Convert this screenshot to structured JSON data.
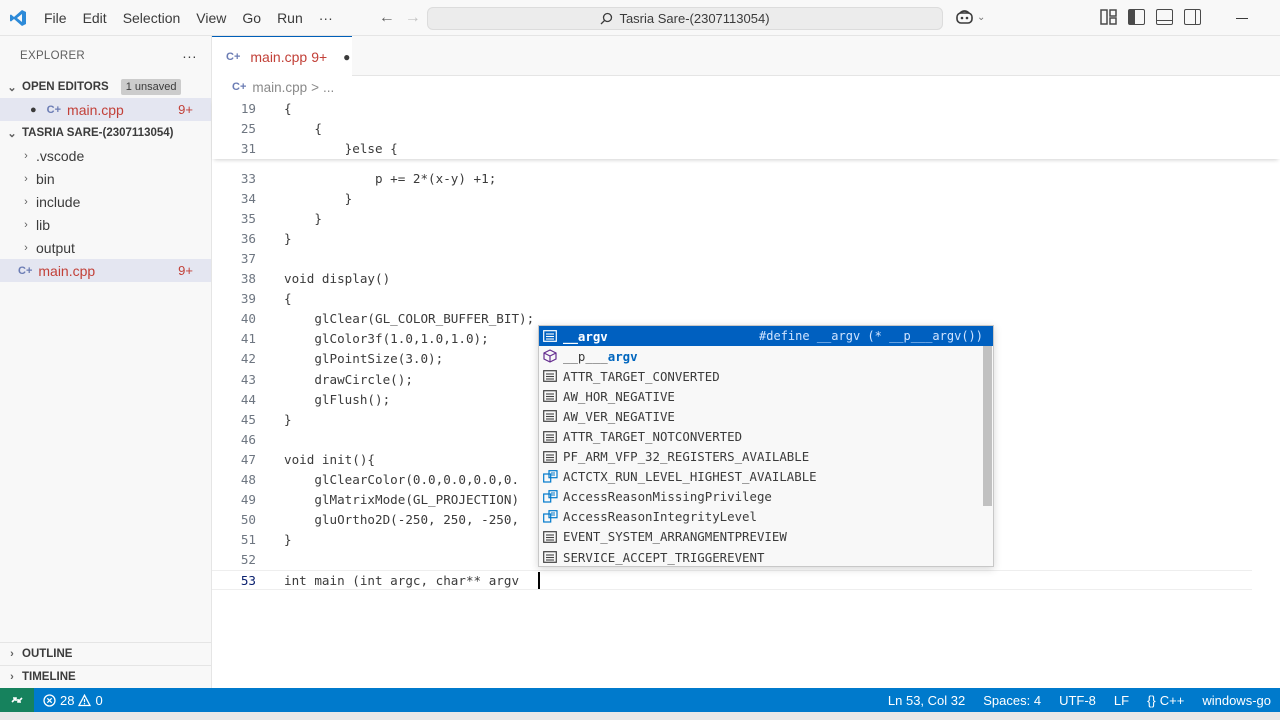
{
  "menu": [
    "File",
    "Edit",
    "Selection",
    "View",
    "Go",
    "Run",
    "···"
  ],
  "command_center": "Tasria Sare-(2307113054)",
  "sidebar": {
    "title": "EXPLORER",
    "more": "···",
    "open_editors": {
      "label": "OPEN EDITORS",
      "badge": "1 unsaved",
      "file": "main.cpp",
      "count": "9+"
    },
    "folder": {
      "label": "TASRIA SARE-(2307113054)",
      "items": [
        ".vscode",
        "bin",
        "include",
        "lib",
        "output"
      ],
      "file": "main.cpp",
      "count": "9+"
    },
    "outline": "OUTLINE",
    "timeline": "TIMELINE"
  },
  "tab": {
    "label": "main.cpp",
    "count": "9+",
    "dirty": "●"
  },
  "breadcrumb": {
    "file": "main.cpp",
    "sep": ">",
    "rest": "..."
  },
  "code": {
    "sticky": [
      {
        "n": "19",
        "t": "{"
      },
      {
        "n": "25",
        "t": "    {"
      },
      {
        "n": "31",
        "t": "        }else {"
      }
    ],
    "lines": [
      {
        "n": "33",
        "t": "            p += 2*(x-y) +1;"
      },
      {
        "n": "34",
        "t": "        }"
      },
      {
        "n": "35",
        "t": "    }"
      },
      {
        "n": "36",
        "t": "}"
      },
      {
        "n": "37",
        "t": ""
      },
      {
        "n": "38",
        "t": "void display()"
      },
      {
        "n": "39",
        "t": "{"
      },
      {
        "n": "40",
        "t": "    glClear(GL_COLOR_BUFFER_BIT);"
      },
      {
        "n": "41",
        "t": "    glColor3f(1.0,1.0,1.0);"
      },
      {
        "n": "42",
        "t": "    glPointSize(3.0);"
      },
      {
        "n": "43",
        "t": "    drawCircle();"
      },
      {
        "n": "44",
        "t": "    glFlush();"
      },
      {
        "n": "45",
        "t": "}"
      },
      {
        "n": "46",
        "t": ""
      },
      {
        "n": "47",
        "t": "void init(){"
      },
      {
        "n": "48",
        "t": "    glClearColor(0.0,0.0,0.0,0."
      },
      {
        "n": "49",
        "t": "    glMatrixMode(GL_PROJECTION)"
      },
      {
        "n": "50",
        "t": "    gluOrtho2D(-250, 250, -250,"
      },
      {
        "n": "51",
        "t": "}"
      },
      {
        "n": "52",
        "t": ""
      },
      {
        "n": "53",
        "t": "int main (int argc, char** argv"
      }
    ]
  },
  "suggest": {
    "detail": "#define __argv (* __p___argv())",
    "items": [
      {
        "icon": "text",
        "pre": "",
        "hl": "__argv",
        "post": ""
      },
      {
        "icon": "cube",
        "pre": "__p___",
        "hl": "argv",
        "post": ""
      },
      {
        "icon": "text",
        "pre": "",
        "hl": "",
        "post": "ATTR_TARGET_CONVERTED"
      },
      {
        "icon": "text",
        "pre": "",
        "hl": "",
        "post": "AW_HOR_NEGATIVE"
      },
      {
        "icon": "text",
        "pre": "",
        "hl": "",
        "post": "AW_VER_NEGATIVE"
      },
      {
        "icon": "text",
        "pre": "",
        "hl": "",
        "post": "ATTR_TARGET_NOTCONVERTED"
      },
      {
        "icon": "text",
        "pre": "",
        "hl": "",
        "post": "PF_ARM_VFP_32_REGISTERS_AVAILABLE"
      },
      {
        "icon": "enum",
        "pre": "",
        "hl": "",
        "post": "ACTCTX_RUN_LEVEL_HIGHEST_AVAILABLE"
      },
      {
        "icon": "enum",
        "pre": "",
        "hl": "",
        "post": "AccessReasonMissingPrivilege"
      },
      {
        "icon": "enum",
        "pre": "",
        "hl": "",
        "post": "AccessReasonIntegrityLevel"
      },
      {
        "icon": "text",
        "pre": "",
        "hl": "",
        "post": "EVENT_SYSTEM_ARRANGMENTPREVIEW"
      },
      {
        "icon": "text",
        "pre": "",
        "hl": "",
        "post": "SERVICE_ACCEPT_TRIGGEREVENT"
      }
    ]
  },
  "status": {
    "errors": "28",
    "warnings": "0",
    "position": "Ln 53, Col 32",
    "spaces": "Spaces: 4",
    "encoding": "UTF-8",
    "eol": "LF",
    "language": "C++",
    "config": "windows-go"
  },
  "colors": {
    "accent": "#005fb8",
    "statusbar": "#007acc",
    "remote": "#16825d",
    "error_red": "#c24038"
  }
}
